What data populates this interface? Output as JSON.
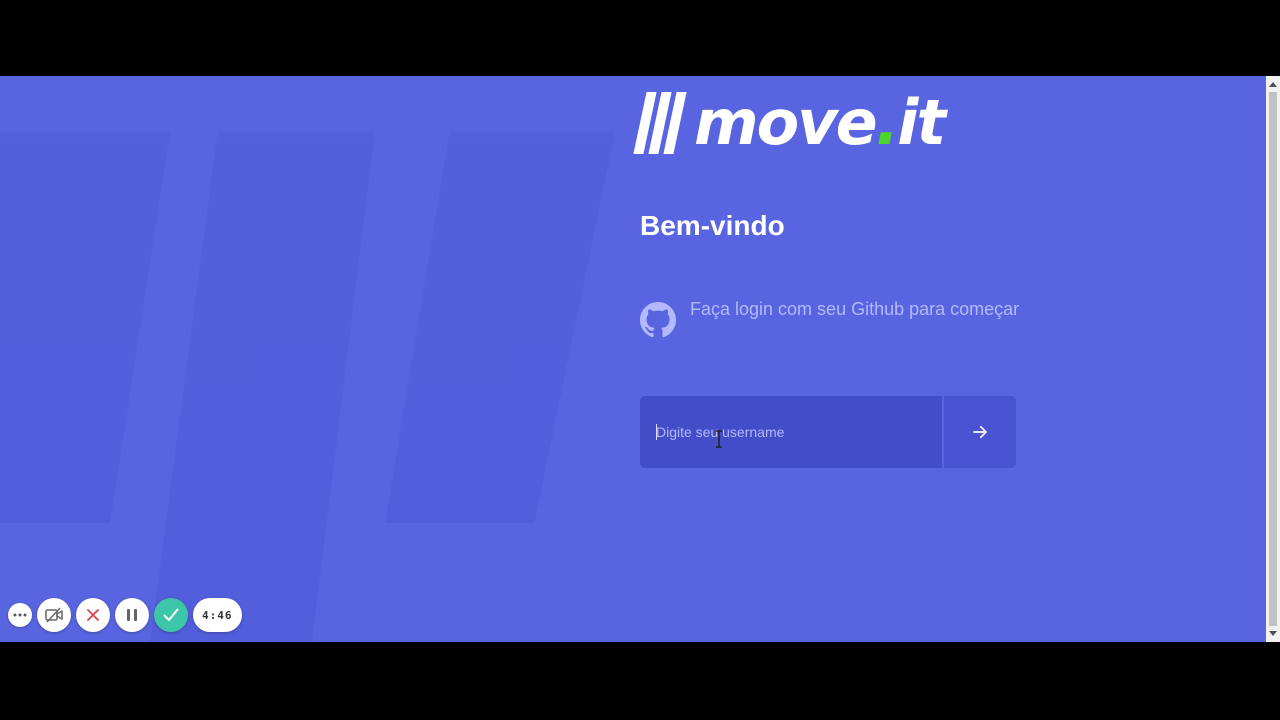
{
  "logo": {
    "text_main": "move",
    "text_dot": ".",
    "text_tail": "it"
  },
  "welcome": {
    "title": "Bem-vindo"
  },
  "github": {
    "icon": "github-icon",
    "message": "Faça login com seu Github para começar"
  },
  "login": {
    "placeholder": "Digite seu username",
    "value": "",
    "submit_icon": "arrow-right-icon"
  },
  "recorder": {
    "timer": "4:46"
  },
  "colors": {
    "background": "#5965e0",
    "text_muted": "#b2b9ff",
    "accent_dot": "#4cd62b",
    "confirm": "#3ec6a8"
  }
}
